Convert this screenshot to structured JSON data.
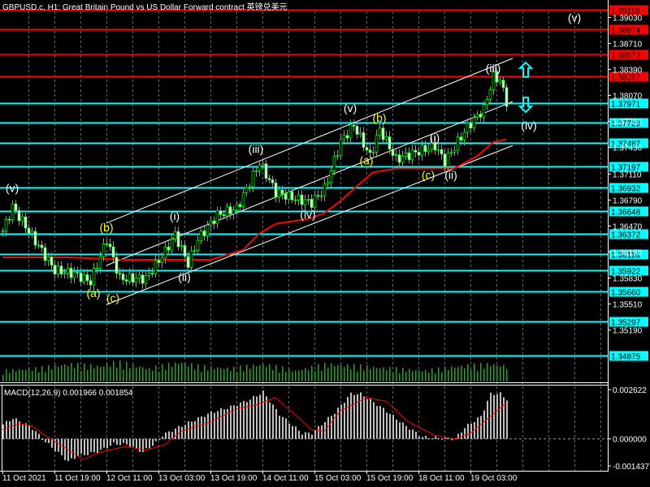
{
  "window": {
    "title": "GBPUSD.c, H1:  Great Britain Pound vs US Dollar Forward contract  英镑兑美元"
  },
  "colors": {
    "background": "#000000",
    "candle": "#00ff00",
    "resistance": "#ff0000",
    "support": "#00ffff",
    "ma": "#ff0000",
    "macd_hist": "#c0c0c0",
    "macd_signal": "#ff0000",
    "wave_white": "#ffffff",
    "wave_yellow": "#ffff00",
    "volume": "#00c000"
  },
  "price_axis": {
    "ticks": [
      "1.39030",
      "1.38710",
      "1.38390",
      "1.38070",
      "1.37750",
      "1.37430",
      "1.37110",
      "1.36790",
      "1.36470",
      "1.36150",
      "1.35830",
      "1.35510",
      "1.35190"
    ]
  },
  "levels": {
    "resistance": [
      "1.39116",
      "1.38874",
      "1.38572",
      "1.38297"
    ],
    "support": [
      "1.37971",
      "1.37729",
      "1.37487",
      "1.37197",
      "1.36932",
      "1.36648",
      "1.36372",
      "1.36116",
      "1.35922",
      "1.35660",
      "1.35297",
      "1.34875"
    ]
  },
  "time_axis": [
    "11 Oct 2021",
    "11 Oct 19:00",
    "12 Oct 11:00",
    "13 Oct 03:00",
    "13 Oct 19:00",
    "14 Oct 11:00",
    "15 Oct 03:00",
    "15 Oct 19:00",
    "18 Oct 11:00",
    "19 Oct 03:00"
  ],
  "wave_labels": [
    {
      "text": "(v)",
      "color": "white",
      "bar": 3,
      "price": 1.3688
    },
    {
      "text": "(b)",
      "color": "yellow",
      "bar": 32,
      "price": 1.364
    },
    {
      "text": "(a)",
      "color": "yellow",
      "bar": 28,
      "price": 1.3559
    },
    {
      "text": "(c)",
      "color": "yellow",
      "bar": 34,
      "price": 1.3553
    },
    {
      "text": "(i)",
      "color": "white",
      "bar": 53,
      "price": 1.3654
    },
    {
      "text": "(ii)",
      "color": "white",
      "bar": 56,
      "price": 1.3579
    },
    {
      "text": "(iii)",
      "color": "white",
      "bar": 78,
      "price": 1.3736
    },
    {
      "text": "(iv)",
      "color": "white",
      "bar": 94,
      "price": 1.3656
    },
    {
      "text": "(v)",
      "color": "white",
      "bar": 107,
      "price": 1.3786
    },
    {
      "text": "(b)",
      "color": "yellow",
      "bar": 116,
      "price": 1.3774
    },
    {
      "text": "(a)",
      "color": "yellow",
      "bar": 112,
      "price": 1.3722
    },
    {
      "text": "(c)",
      "color": "yellow",
      "bar": 131,
      "price": 1.3704
    },
    {
      "text": "(i)",
      "color": "white",
      "bar": 133,
      "price": 1.375
    },
    {
      "text": "(ii)",
      "color": "white",
      "bar": 138,
      "price": 1.3704
    },
    {
      "text": "(iii)",
      "color": "white",
      "bar": 151,
      "price": 1.3835
    },
    {
      "text": "(iv)",
      "color": "white",
      "bar": 162,
      "price": 1.3765
    },
    {
      "text": "(v)",
      "color": "white",
      "bar": 176,
      "price": 1.3897
    }
  ],
  "arrows": [
    {
      "direction": "up",
      "bar": 161,
      "price": 1.3838
    },
    {
      "direction": "down",
      "bar": 161,
      "price": 1.3795
    }
  ],
  "channel": [
    {
      "from": [
        32,
        1.365
      ],
      "to": [
        157,
        1.3852
      ]
    },
    {
      "from": [
        32,
        1.3598
      ],
      "to": [
        157,
        1.3799
      ]
    },
    {
      "from": [
        32,
        1.355
      ],
      "to": [
        157,
        1.3745
      ]
    }
  ],
  "price_path": [
    [
      0,
      1.364
    ],
    [
      3,
      1.367
    ],
    [
      8,
      1.364
    ],
    [
      16,
      1.3592
    ],
    [
      22,
      1.3588
    ],
    [
      27,
      1.3578
    ],
    [
      32,
      1.363
    ],
    [
      36,
      1.3582
    ],
    [
      44,
      1.3582
    ],
    [
      50,
      1.3615
    ],
    [
      53,
      1.3636
    ],
    [
      57,
      1.36
    ],
    [
      60,
      1.363
    ],
    [
      66,
      1.366
    ],
    [
      72,
      1.3668
    ],
    [
      79,
      1.3724
    ],
    [
      84,
      1.3688
    ],
    [
      90,
      1.368
    ],
    [
      95,
      1.3675
    ],
    [
      99,
      1.3692
    ],
    [
      104,
      1.375
    ],
    [
      108,
      1.377
    ],
    [
      113,
      1.3732
    ],
    [
      116,
      1.3765
    ],
    [
      121,
      1.3728
    ],
    [
      128,
      1.3738
    ],
    [
      133,
      1.3745
    ],
    [
      136,
      1.3725
    ],
    [
      143,
      1.3768
    ],
    [
      148,
      1.379
    ],
    [
      151,
      1.383
    ],
    [
      153,
      1.3825
    ],
    [
      155,
      1.3799
    ]
  ],
  "ma_path": [
    [
      0,
      1.3608
    ],
    [
      20,
      1.3608
    ],
    [
      38,
      1.3605
    ],
    [
      64,
      1.3605
    ],
    [
      74,
      1.3617
    ],
    [
      79,
      1.3637
    ],
    [
      84,
      1.3649
    ],
    [
      94,
      1.3655
    ],
    [
      99,
      1.3662
    ],
    [
      104,
      1.3677
    ],
    [
      109,
      1.3695
    ],
    [
      114,
      1.3712
    ],
    [
      121,
      1.3717
    ],
    [
      139,
      1.3717
    ],
    [
      146,
      1.3732
    ],
    [
      151,
      1.3749
    ],
    [
      156,
      1.3754
    ]
  ],
  "volume_profile": [
    [
      0,
      0.5
    ],
    [
      10,
      0.6
    ],
    [
      20,
      0.8
    ],
    [
      30,
      0.7
    ],
    [
      35,
      0.9
    ],
    [
      45,
      0.6
    ],
    [
      55,
      0.9
    ],
    [
      60,
      0.7
    ],
    [
      70,
      0.6
    ],
    [
      80,
      0.8
    ],
    [
      90,
      0.5
    ],
    [
      100,
      0.8
    ],
    [
      110,
      0.7
    ],
    [
      120,
      0.6
    ],
    [
      130,
      0.5
    ],
    [
      140,
      0.7
    ],
    [
      150,
      0.8
    ],
    [
      155,
      0.7
    ]
  ],
  "macd": {
    "label": "MACD(12,26,9) 0.001966 0.001854",
    "axis": [
      "0.002622",
      "0.000000",
      "-0.001437"
    ],
    "range": [
      -0.001437,
      0.002622
    ],
    "histogram": [
      [
        0,
        0.00077
      ],
      [
        3,
        0.0011
      ],
      [
        8,
        0.0007
      ],
      [
        10,
        0.0004
      ],
      [
        12,
        0
      ],
      [
        16,
        -0.0006
      ],
      [
        20,
        -0.0012
      ],
      [
        23,
        -0.0009
      ],
      [
        29,
        -0.0007
      ],
      [
        34,
        -0.00026
      ],
      [
        38,
        -0.0003
      ],
      [
        43,
        -0.0007
      ],
      [
        47,
        -0.0002
      ],
      [
        49,
        0.0002
      ],
      [
        55,
        0.0007
      ],
      [
        64,
        0.0014
      ],
      [
        70,
        0.0017
      ],
      [
        76,
        0.0021
      ],
      [
        80,
        0.0025
      ],
      [
        85,
        0.0013
      ],
      [
        92,
        0.0003
      ],
      [
        95,
        0.0003
      ],
      [
        102,
        0.0014
      ],
      [
        107,
        0.0024
      ],
      [
        110,
        0.0024
      ],
      [
        117,
        0.0016
      ],
      [
        123,
        0.0008
      ],
      [
        129,
        0.0001
      ],
      [
        139,
        0
      ],
      [
        142,
        0.0006
      ],
      [
        147,
        0.0012
      ],
      [
        150,
        0.0024
      ],
      [
        153,
        0.0024
      ],
      [
        155,
        0.0021
      ]
    ],
    "signal": [
      [
        0,
        0.0005
      ],
      [
        5,
        0.0008
      ],
      [
        9,
        0.0007
      ],
      [
        13,
        0.0002
      ],
      [
        25,
        -0.0011
      ],
      [
        30,
        -0.0007
      ],
      [
        38,
        -0.0004
      ],
      [
        44,
        -0.0006
      ],
      [
        50,
        -0.0003
      ],
      [
        55,
        0.0004
      ],
      [
        64,
        0.0009
      ],
      [
        72,
        0.0016
      ],
      [
        78,
        0.0018
      ],
      [
        84,
        0.0022
      ],
      [
        90,
        0.0013
      ],
      [
        95,
        0.0005
      ],
      [
        99,
        0.0004
      ],
      [
        104,
        0.0015
      ],
      [
        112,
        0.0022
      ],
      [
        118,
        0.002
      ],
      [
        125,
        0.0009
      ],
      [
        133,
        0.0002
      ],
      [
        139,
        0
      ],
      [
        144,
        0.0003
      ],
      [
        155,
        0.0019
      ]
    ]
  }
}
